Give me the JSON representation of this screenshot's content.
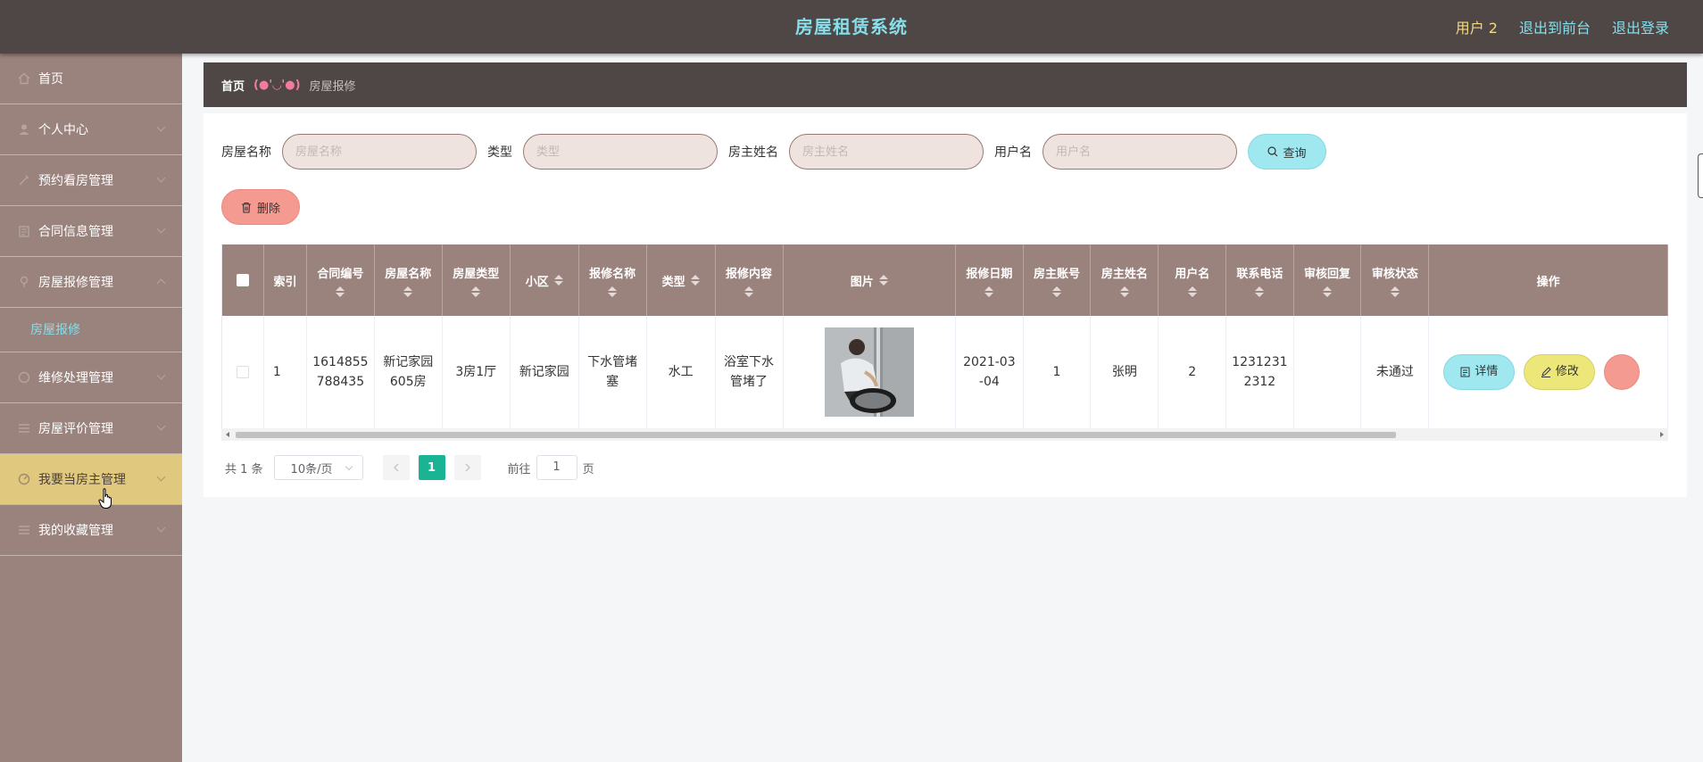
{
  "header": {
    "title": "房屋租赁系统",
    "user": "用户 2",
    "links": [
      "退出到前台",
      "退出登录"
    ]
  },
  "sidebar": {
    "items": [
      {
        "label": "首页",
        "icon": "home-icon"
      },
      {
        "label": "个人中心",
        "icon": "user-icon"
      },
      {
        "label": "预约看房管理",
        "icon": "calendar-icon"
      },
      {
        "label": "合同信息管理",
        "icon": "document-icon"
      },
      {
        "label": "房屋报修管理",
        "icon": "wrench-icon",
        "expanded": true,
        "sub": "房屋报修"
      },
      {
        "label": "维修处理管理",
        "icon": "tool-icon"
      },
      {
        "label": "房屋评价管理",
        "icon": "list-icon"
      },
      {
        "label": "我要当房主管理",
        "icon": "dashboard-icon",
        "active": true
      },
      {
        "label": "我的收藏管理",
        "icon": "list-icon"
      }
    ]
  },
  "breadcrumb": {
    "home": "首页",
    "separator": "(●'◡'●)",
    "current": "房屋报修"
  },
  "filters": [
    {
      "label": "房屋名称",
      "placeholder": "房屋名称"
    },
    {
      "label": "类型",
      "placeholder": "类型"
    },
    {
      "label": "房主姓名",
      "placeholder": "房主姓名"
    },
    {
      "label": "用户名",
      "placeholder": "用户名"
    }
  ],
  "buttons": {
    "query": "查询",
    "delete": "删除"
  },
  "table": {
    "columns": [
      "索引",
      "合同编号",
      "房屋名称",
      "房屋类型",
      "小区",
      "报修名称",
      "类型",
      "报修内容",
      "图片",
      "报修日期",
      "房主账号",
      "房主姓名",
      "用户名",
      "联系电话",
      "审核回复",
      "审核状态",
      "操作"
    ],
    "rows": [
      {
        "index": "1",
        "contract_no": "1614855788435",
        "house_name": "新记家园605房",
        "house_type": "3房1厅",
        "community": "新记家园",
        "repair_name": "下水管堵塞",
        "type": "水工",
        "repair_content": "浴室下水管堵了",
        "image": "plumber-photo",
        "date": "2021-03-04",
        "owner_account": "1",
        "owner_name": "张明",
        "username": "2",
        "phone": "12312312312",
        "review_reply": "",
        "review_status": "未通过"
      }
    ],
    "actions": {
      "detail": "详情",
      "edit": "修改"
    }
  },
  "pagination": {
    "total": "共 1 条",
    "page_size": "10条/页",
    "current_page": "1",
    "goto_label": "前往",
    "goto_value": "1",
    "page_unit": "页"
  },
  "colors": {
    "header_bg": "#4f4745",
    "sidebar_bg": "#9a827d",
    "active_bg": "#e0c87f",
    "accent_cyan": "#86dfeb",
    "pager_active": "#1ab394"
  }
}
